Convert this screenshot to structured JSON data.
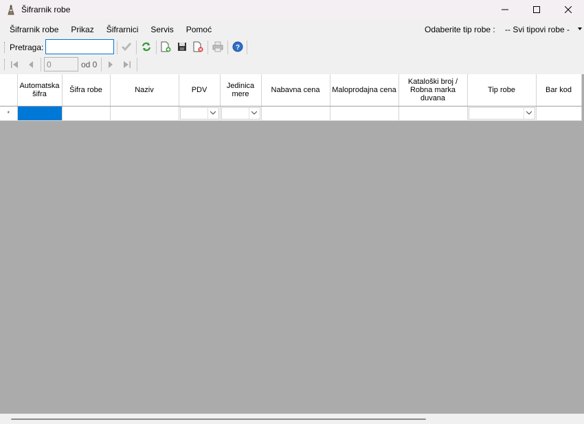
{
  "window": {
    "title": "Šifrarnik robe",
    "icon": "app-logo-icon"
  },
  "menu": {
    "items": [
      "Šifrarnik robe",
      "Prikaz",
      "Šifrarnici",
      "Servis",
      "Pomoć"
    ],
    "tip_label": "Odaberite tip robe :",
    "tip_value": "-- Svi tipovi robe -"
  },
  "toolbar": {
    "search_label": "Pretraga:",
    "search_value": "",
    "icons": [
      "checkmark-icon",
      "refresh-icon",
      "new-document-icon",
      "save-icon",
      "delete-document-icon",
      "print-icon",
      "help-icon"
    ]
  },
  "navigator": {
    "position": "0",
    "of_label": "od 0"
  },
  "grid": {
    "columns": [
      "Automatska šifra",
      "Šifra robe",
      "Naziv",
      "PDV",
      "Jedinica mere",
      "Nabavna cena",
      "Maloprodajna cena",
      "Kataloški broj / Robna marka duvana",
      "Tip robe",
      "Bar kod"
    ],
    "new_row_marker": "*"
  },
  "colors": {
    "selection": "#0078d7",
    "grid_background": "#ababab"
  }
}
